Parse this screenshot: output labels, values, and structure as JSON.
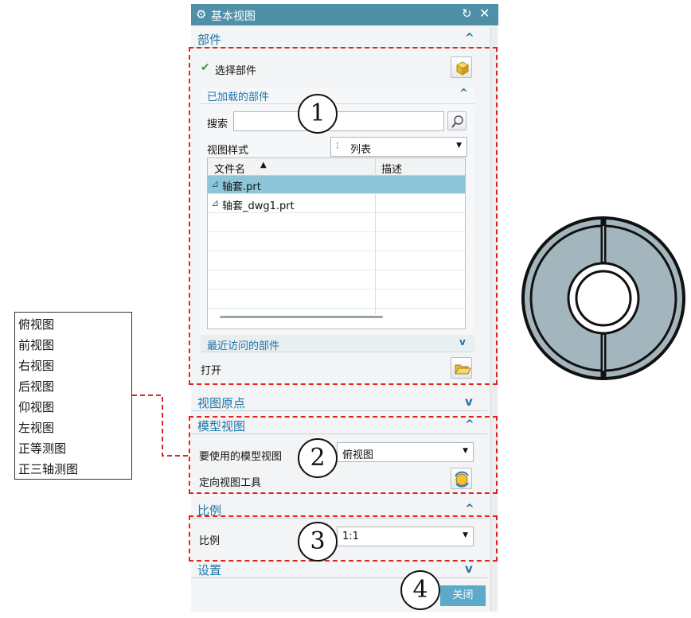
{
  "dialog": {
    "title": "基本视图",
    "sections": {
      "part": "部件",
      "view_origin": "视图原点",
      "model_view": "模型视图",
      "scale": "比例",
      "settings": "设置"
    },
    "select_part": "选择部件",
    "loaded_parts": {
      "header": "已加载的部件",
      "search_label": "搜索",
      "search_value": "",
      "view_style_label": "视图样式",
      "view_style_value": "列表",
      "columns": [
        "文件名",
        "描述"
      ],
      "files": [
        "轴套.prt",
        "轴套_dwg1.prt"
      ]
    },
    "recent_parts": "最近访问的部件",
    "open_label": "打开",
    "model_view_label": "要使用的模型视图",
    "model_view_value": "俯视图",
    "orient_tool_label": "定向视图工具",
    "scale_label": "比例",
    "scale_value": "1:1",
    "close_button": "关闭"
  },
  "view_list": [
    "俯视图",
    "前视图",
    "右视图",
    "后视图",
    "仰视图",
    "左视图",
    "正等测图",
    "正三轴测图"
  ],
  "callouts": [
    "1",
    "2",
    "3",
    "4"
  ],
  "colors": {
    "title_bar": "#4f8fa7",
    "section_text": "#1f74a7",
    "selected_row": "#8ec6d9",
    "annotation_red": "#e0231f",
    "part_fill": "#a4b6bd"
  }
}
